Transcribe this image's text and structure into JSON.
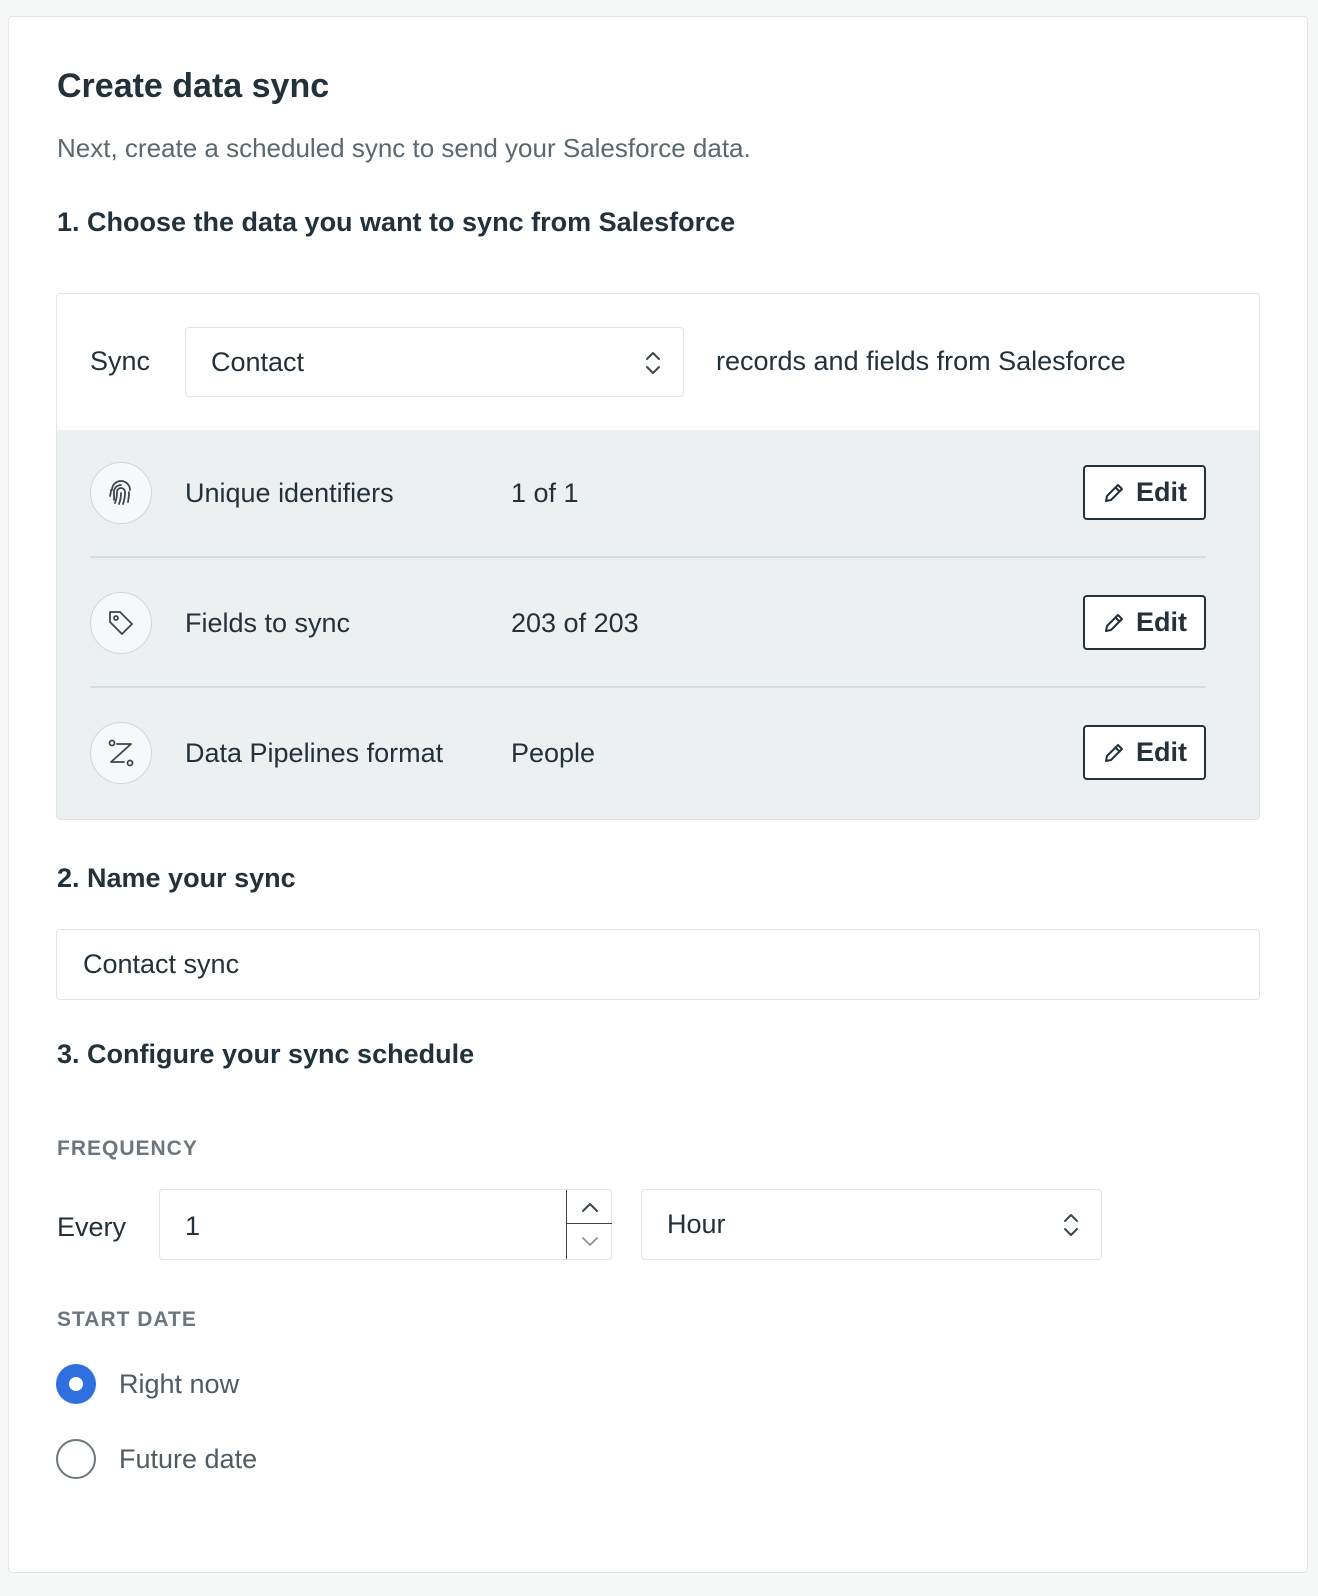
{
  "header": {
    "title": "Create data sync",
    "subtitle": "Next, create a scheduled sync to send your Salesforce data."
  },
  "step1": {
    "heading": "1. Choose the data you want to sync from Salesforce",
    "sync_label": "Sync",
    "object_select": {
      "value": "Contact",
      "icon": "chevron-updown-icon"
    },
    "sync_suffix": "records and fields from Salesforce",
    "rows": [
      {
        "label": "Unique identifiers",
        "value": "1 of 1",
        "icon": "fingerprint-icon",
        "button": "Edit"
      },
      {
        "label": "Fields to sync",
        "value": "203 of 203",
        "icon": "tag-icon",
        "button": "Edit"
      },
      {
        "label": "Data Pipelines format",
        "value": "People",
        "icon": "mapping-icon",
        "button": "Edit"
      }
    ]
  },
  "step2": {
    "heading": "2. Name your sync",
    "name_value": "Contact sync"
  },
  "step3": {
    "heading": "3. Configure your sync schedule",
    "frequency_label": "FREQUENCY",
    "every_label": "Every",
    "interval_value": "1",
    "unit_select": {
      "value": "Hour"
    },
    "start_date_label": "START DATE",
    "start_options": [
      {
        "label": "Right now",
        "checked": true
      },
      {
        "label": "Future date",
        "checked": false
      }
    ]
  },
  "colors": {
    "accent": "#2f6fe0",
    "text": "#22313a",
    "muted": "#5b6870",
    "panel": "#edf0f1"
  }
}
